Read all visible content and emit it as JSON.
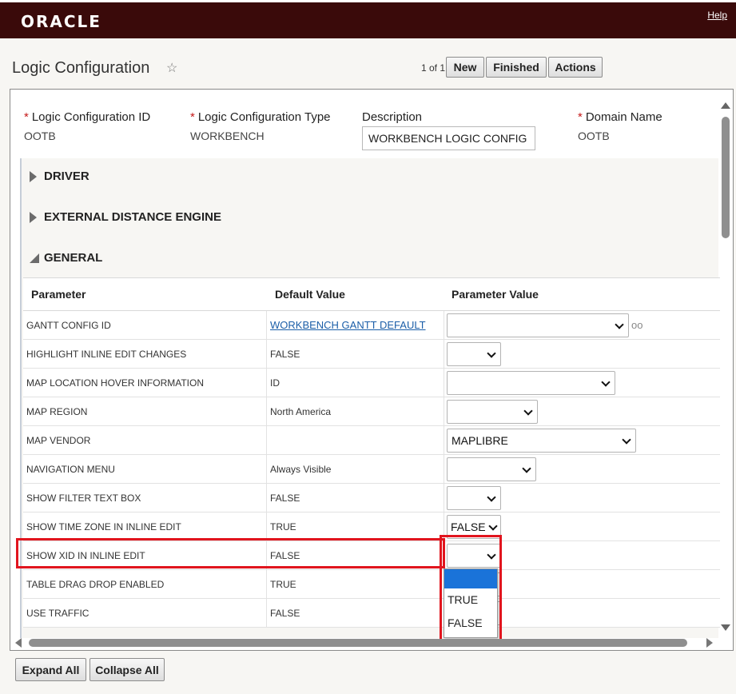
{
  "header": {
    "logo": "ORACLE",
    "help": "Help"
  },
  "page": {
    "title": "Logic Configuration",
    "star_icon": "star-icon",
    "pager": "1 of 1",
    "new_label": "New",
    "finished_label": "Finished",
    "actions_label": "Actions"
  },
  "fields": [
    {
      "label": "Logic Configuration ID",
      "required": true,
      "value": "OOTB"
    },
    {
      "label": "Logic Configuration Type",
      "required": true,
      "value": "WORKBENCH"
    },
    {
      "label": "Description",
      "required": false,
      "value": "WORKBENCH LOGIC CONFIG"
    },
    {
      "label": "Domain Name",
      "required": true,
      "value": "OOTB"
    }
  ],
  "sections": [
    {
      "label": "DRIVER",
      "expanded": false
    },
    {
      "label": "EXTERNAL DISTANCE ENGINE",
      "expanded": false
    },
    {
      "label": "GENERAL",
      "expanded": true
    }
  ],
  "table": {
    "headers": [
      "Parameter",
      "Default Value",
      "Parameter Value"
    ],
    "rows": [
      {
        "param": "GANTT CONFIG ID",
        "default": "WORKBENCH GANTT DEFAULT",
        "value": ""
      },
      {
        "param": "HIGHLIGHT INLINE EDIT CHANGES",
        "default": "FALSE",
        "value": ""
      },
      {
        "param": "MAP LOCATION HOVER INFORMATION",
        "default": "ID",
        "value": ""
      },
      {
        "param": "MAP REGION",
        "default": "North America",
        "value": ""
      },
      {
        "param": "MAP VENDOR",
        "default": "",
        "value": "MAPLIBRE"
      },
      {
        "param": "NAVIGATION MENU",
        "default": "Always Visible",
        "value": ""
      },
      {
        "param": "SHOW FILTER TEXT BOX",
        "default": "FALSE",
        "value": ""
      },
      {
        "param": "SHOW TIME ZONE IN INLINE EDIT",
        "default": "TRUE",
        "value": "FALSE"
      },
      {
        "param": "SHOW XID IN INLINE EDIT",
        "default": "FALSE",
        "value": ""
      },
      {
        "param": "TABLE DRAG DROP ENABLED",
        "default": "TRUE",
        "value": ""
      },
      {
        "param": "USE TRAFFIC",
        "default": "FALSE",
        "value": ""
      }
    ]
  },
  "dropdown": {
    "options": [
      "",
      "TRUE",
      "FALSE"
    ],
    "highlighted_index": 0
  },
  "footer": {
    "expand_all": "Expand All",
    "collapse_all": "Collapse All"
  },
  "colors": {
    "topbar": "#3a0a0a",
    "highlight": "#e1151e",
    "link": "#1b5ea8",
    "selected_option": "#1a73d9"
  }
}
